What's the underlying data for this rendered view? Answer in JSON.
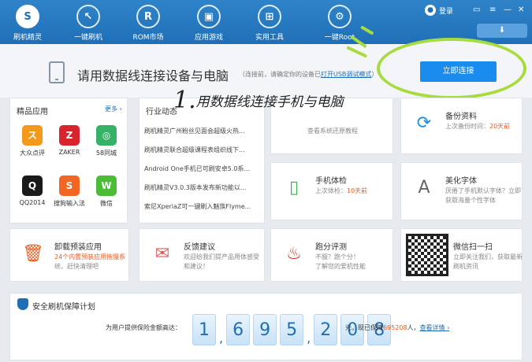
{
  "nav": [
    {
      "label": "刷机精灵",
      "icon": "shield-icon"
    },
    {
      "label": "一键刷机",
      "icon": "cursor-icon"
    },
    {
      "label": "ROM市场",
      "icon": "rom-icon"
    },
    {
      "label": "应用游戏",
      "icon": "bag-icon"
    },
    {
      "label": "实用工具",
      "icon": "grid-icon"
    },
    {
      "label": "一键Root",
      "icon": "root-icon"
    }
  ],
  "login": "登录",
  "connect": {
    "title": "请用数据线连接设备与电脑",
    "sub_prefix": "（连接前，请确定你的设备已",
    "sub_link": "打开USB调试模式",
    "sub_suffix": "）",
    "button": "立即连接"
  },
  "overlay": {
    "num": "1.",
    "text": "用数据线连接手机与电脑"
  },
  "apps": {
    "title": "精品应用",
    "more": "更多 ›",
    "items": [
      {
        "name": "大众点评",
        "glyph": "ス",
        "color": "#f39a1d"
      },
      {
        "name": "ZAKER",
        "glyph": "Z",
        "color": "#d8242c"
      },
      {
        "name": "58同城",
        "glyph": "◎",
        "color": "#35b267"
      },
      {
        "name": "QQ2014",
        "glyph": "Q",
        "color": "#1a1a1a"
      },
      {
        "name": "搜狗输入法",
        "glyph": "S",
        "color": "#f26522"
      },
      {
        "name": "微信",
        "glyph": "W",
        "color": "#4cbc37"
      }
    ]
  },
  "news": {
    "title": "行业动态",
    "items": [
      "刷机精灵广州粉丝见面会超级火热...",
      "刷机精灵联合超级课程表组织线下...",
      "Android One手机已可刷安卓5.0系...",
      "刷机精灵V3.0.3版本发布新功能以...",
      "索尼XperiaZ可一键刷入魅族Flyme..."
    ]
  },
  "tiles": [
    {
      "title": "",
      "sub": "查看系统还原教程",
      "sub2": ""
    },
    {
      "title": "备份资料",
      "sub": "上次备份时间：",
      "hl": "20天前",
      "sub2": ""
    },
    {
      "title": "手机体检",
      "sub": "上次体检：",
      "hl": "10天前",
      "sub2": ""
    },
    {
      "title": "美化字体",
      "sub": "厌倦了手机默认字体？立即",
      "sub2": "获取海量个性字体"
    },
    {
      "title": "卸载预装应用",
      "sub": "24个内置预装应用拖慢系",
      "sub2": "统，赶快清理吧"
    },
    {
      "title": "反馈建议",
      "sub": "欢迎给我们提产品用体感受",
      "sub2": "和建议！"
    },
    {
      "title": "跑分评测",
      "sub": "不服？跑个分！",
      "sub2": "了解您的爱机性能"
    },
    {
      "title": "微信扫一扫",
      "sub": "立即关注我们，获取最新",
      "sub2": "刷机资讯"
    }
  ],
  "insurance": {
    "title": "安全刷机保障计划",
    "label": "为用户提供保险金额高达：",
    "digits": [
      "1",
      "6",
      "9",
      "5",
      "2",
      "0",
      "8"
    ],
    "unit": "元，现已保障",
    "count": "695208",
    "suffix": "人，",
    "link": "查看详情 ›"
  },
  "colors": {
    "accent": "#1a8cf0",
    "topbar": "#1f6fb7",
    "highlight": "#a7db3e",
    "orange": "#f05a1a"
  }
}
